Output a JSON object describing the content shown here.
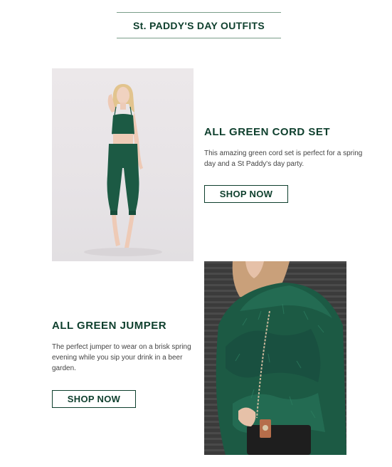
{
  "header": {
    "title": "St. PADDY'S DAY OUTFITS"
  },
  "products": [
    {
      "title": "ALL GREEN CORD SET",
      "description": "This amazing green cord set is perfect for a spring day and a St Paddy's day party.",
      "button": "SHOP NOW",
      "image": "model-green-cord-set-photo"
    },
    {
      "title": "ALL GREEN JUMPER",
      "description": "The perfect jumper to wear on a brisk spring evening while you sip your drink in a beer garden.",
      "button": "SHOP NOW",
      "image": "green-faux-fur-jumper-photo"
    }
  ],
  "colors": {
    "brand_green": "#0e3f2d",
    "outfit_green": "#1c5a44",
    "rule": "#7a9e8a"
  }
}
